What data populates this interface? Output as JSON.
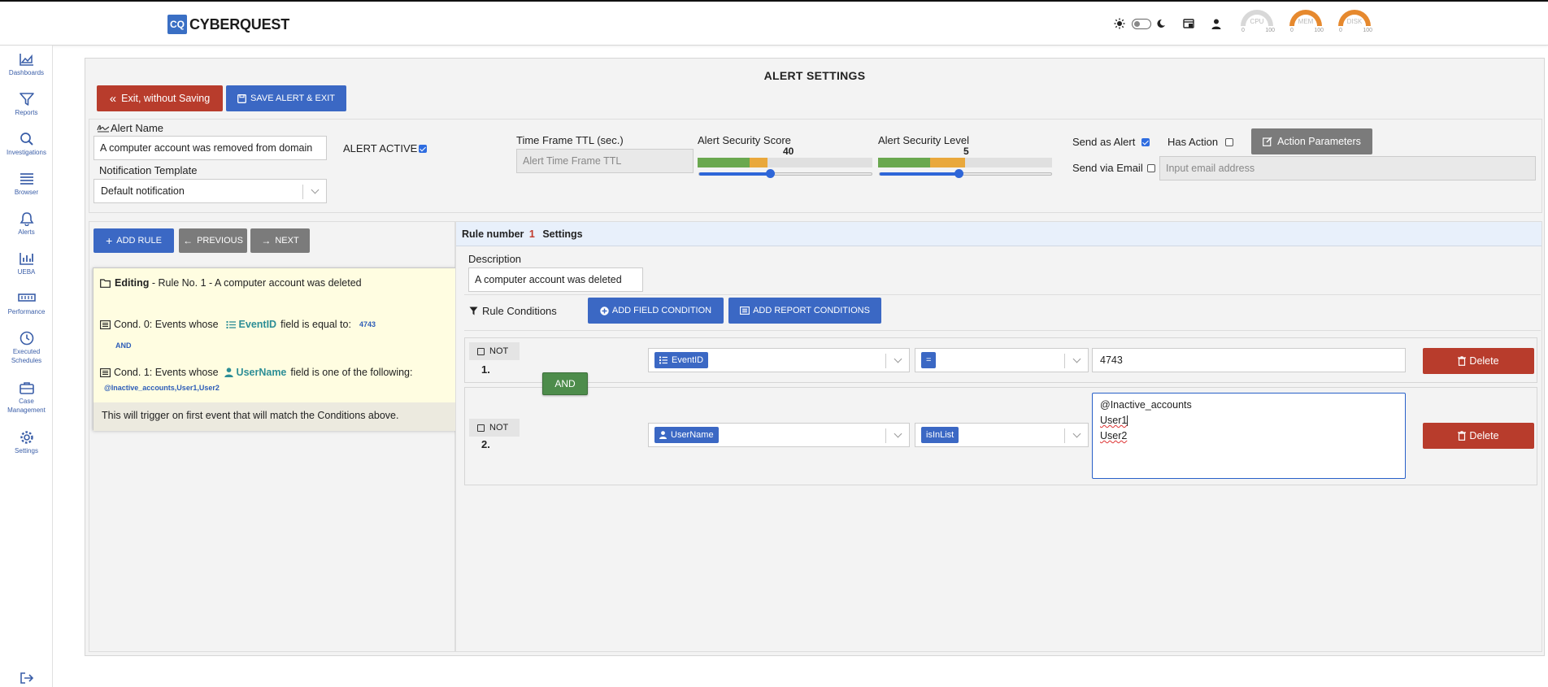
{
  "app": {
    "logo_mark": "CQ",
    "name": "CYBERQUEST"
  },
  "topbar": {
    "gauges": [
      {
        "label": "CPU",
        "min": "0",
        "max": "100",
        "color": "#cfcfcf"
      },
      {
        "label": "MEM",
        "min": "0",
        "max": "100",
        "color": "#e6892e"
      },
      {
        "label": "DISK",
        "min": "0",
        "max": "100",
        "color": "#e6892e"
      }
    ]
  },
  "sidebar": {
    "items": [
      {
        "label": "Dashboards",
        "icon": "chart-area-icon"
      },
      {
        "label": "Reports",
        "icon": "filter-icon"
      },
      {
        "label": "Investigations",
        "icon": "search-icon"
      },
      {
        "label": "Browser",
        "icon": "list-icon"
      },
      {
        "label": "Alerts",
        "icon": "bell-icon"
      },
      {
        "label": "UEBA",
        "icon": "bar-chart-icon"
      },
      {
        "label": "Performance",
        "icon": "performance-icon"
      },
      {
        "label": "Executed",
        "label2": "Schedules",
        "icon": "clock-icon"
      },
      {
        "label": "Case",
        "label2": "Management",
        "icon": "briefcase-icon"
      },
      {
        "label": "Settings",
        "icon": "gear-icon"
      }
    ]
  },
  "page": {
    "title": "ALERT SETTINGS",
    "exit_label": "Exit, without Saving",
    "save_label": "SAVE ALERT & EXIT"
  },
  "alert": {
    "name_label": "Alert Name",
    "name_value": "A computer account was removed from domain",
    "active_label": "ALERT ACTIVE",
    "active": true,
    "template_label": "Notification Template",
    "template_value": "Default notification",
    "ttl_label": "Time Frame TTL (sec.)",
    "ttl_placeholder": "Alert Time Frame TTL",
    "score_label": "Alert Security Score",
    "score_value": "40",
    "score_fraction": 0.4,
    "level_label": "Alert Security Level",
    "level_value": "5",
    "level_fraction": 0.45,
    "send_alert_label": "Send as Alert",
    "send_alert": true,
    "has_action_label": "Has Action",
    "has_action": false,
    "action_params_label": "Action Parameters",
    "send_email_label": "Send via Email",
    "send_email": false,
    "email_placeholder": "Input email address"
  },
  "rules_toolbar": {
    "add_rule": "ADD RULE",
    "previous": "PREVIOUS",
    "next": "NEXT"
  },
  "rule_card": {
    "editing_label": "Editing",
    "editing_text": " - Rule No. 1 - A computer account was deleted",
    "cond0_prefix": "Cond. 0: Events whose",
    "cond0_field": "EventID",
    "cond0_suffix": "field is equal to:",
    "cond0_value": "4743",
    "and_label": "AND",
    "cond1_prefix": "Cond. 1: Events whose",
    "cond1_field": "UserName",
    "cond1_suffix": "field is one of the following:",
    "cond1_value": "@Inactive_accounts,User1,User2",
    "trigger_note": "This will trigger on first event that will match the Conditions above."
  },
  "rule_settings": {
    "head_prefix": "Rule number",
    "head_number": "1",
    "head_suffix": "Settings",
    "description_label": "Description",
    "description_value": "A computer account was deleted",
    "conditions_label": "Rule Conditions",
    "add_field_condition": "ADD FIELD CONDITION",
    "add_report_conditions": "ADD REPORT CONDITIONS",
    "and_badge": "AND",
    "rows": [
      {
        "not_label": "NOT",
        "number": "1.",
        "field": "EventID",
        "operator": "=",
        "value": "4743",
        "delete": "Delete"
      },
      {
        "not_label": "NOT",
        "number": "2.",
        "field": "UserName",
        "operator": "isInList",
        "values": [
          "@Inactive_accounts",
          "User1",
          "User2"
        ],
        "delete": "Delete"
      }
    ]
  }
}
